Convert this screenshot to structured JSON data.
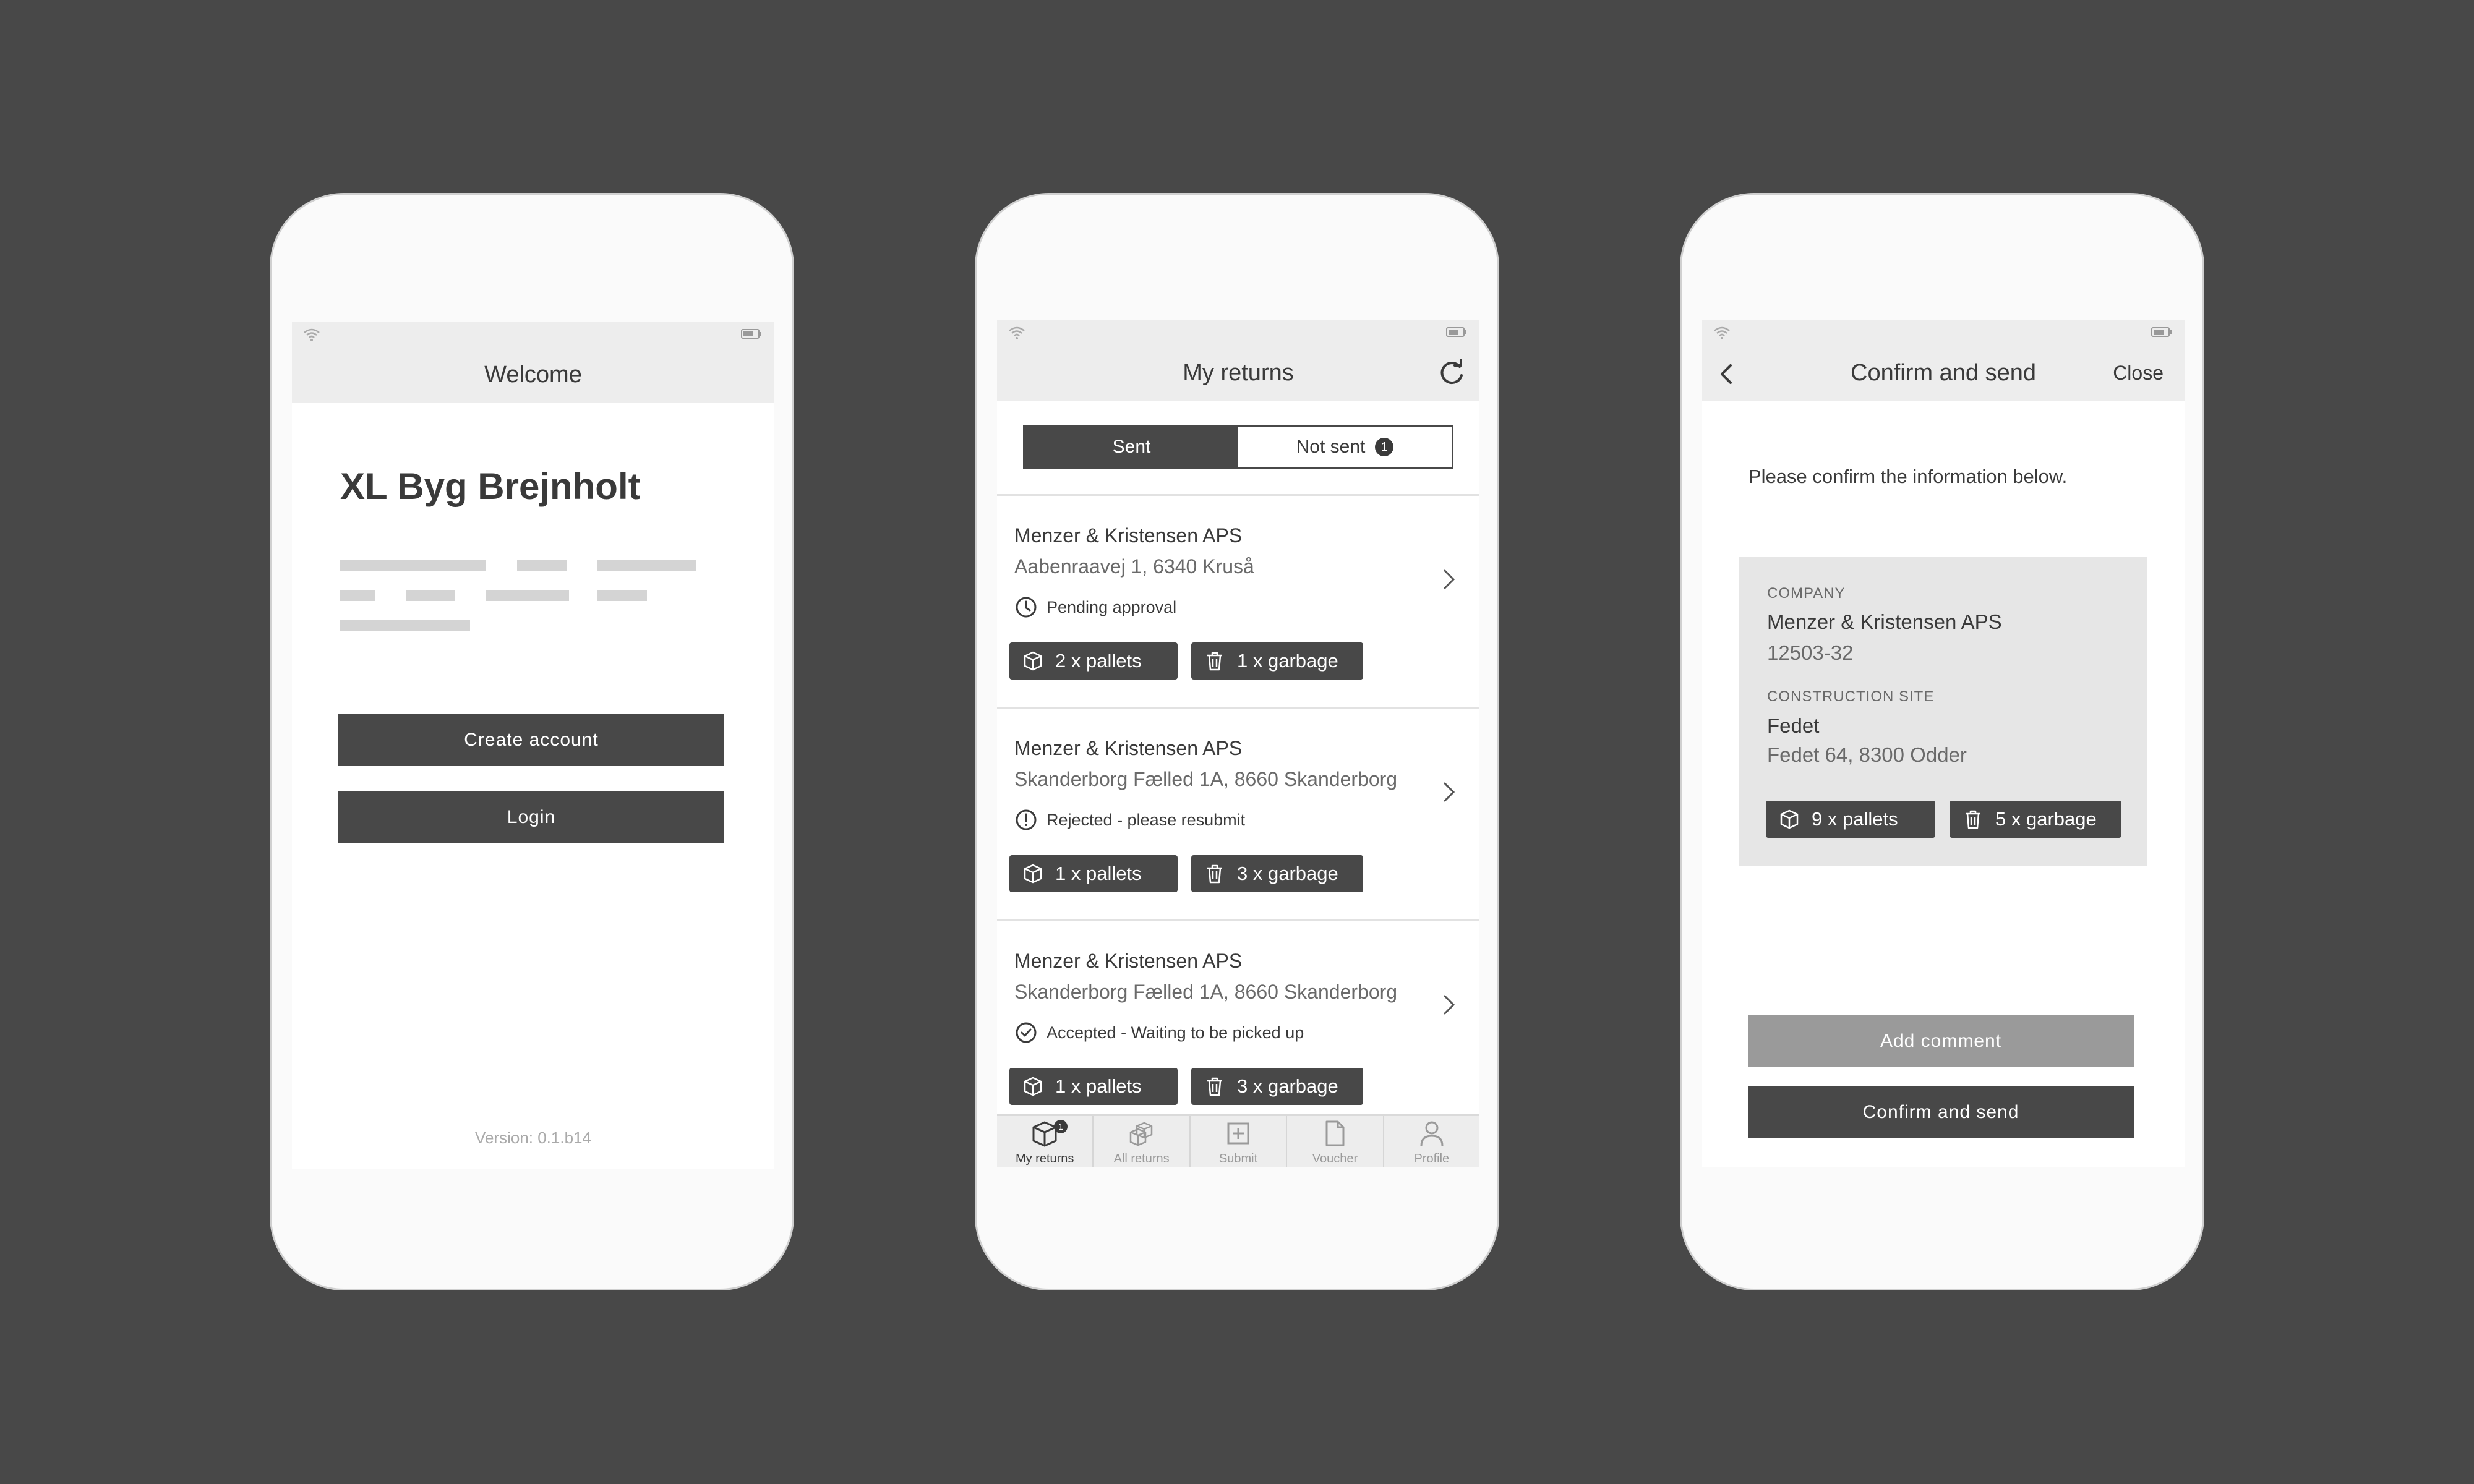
{
  "welcome_screen": {
    "title": "Welcome",
    "brand": "XL Byg Brejnholt",
    "create_account_label": "Create account",
    "login_label": "Login",
    "version": "Version: 0.1.b14"
  },
  "returns_screen": {
    "title": "My returns",
    "segments": {
      "sent": "Sent",
      "not_sent": "Not sent",
      "not_sent_count": "1"
    },
    "returns": [
      {
        "company": "Menzer & Kristensen APS",
        "address": "Aabenraavej 1, 6340 Kruså",
        "status": "Pending approval",
        "status_icon": "clock-icon",
        "pallets": "2 x pallets",
        "garbage": "1 x garbage"
      },
      {
        "company": "Menzer & Kristensen APS",
        "address": "Skanderborg Fælled 1A, 8660 Skanderborg",
        "status": "Rejected - please resubmit",
        "status_icon": "alert-icon",
        "pallets": "1 x pallets",
        "garbage": "3 x garbage"
      },
      {
        "company": "Menzer & Kristensen APS",
        "address": "Skanderborg Fælled 1A, 8660 Skanderborg",
        "status": "Accepted - Waiting to be picked up",
        "status_icon": "check-icon",
        "pallets": "1 x pallets",
        "garbage": "3 x garbage"
      }
    ],
    "tabs": [
      {
        "label": "My returns",
        "icon": "box-icon",
        "badge": "1",
        "active": true
      },
      {
        "label": "All returns",
        "icon": "boxes-icon"
      },
      {
        "label": "Submit",
        "icon": "plus-square-icon"
      },
      {
        "label": "Voucher",
        "icon": "document-icon"
      },
      {
        "label": "Profile",
        "icon": "person-icon"
      }
    ]
  },
  "confirm_screen": {
    "title": "Confirm and send",
    "close_label": "Close",
    "intro": "Please confirm the information below.",
    "company_label": "COMPANY",
    "company_name": "Menzer & Kristensen APS",
    "company_id": "12503-32",
    "site_label": "CONSTRUCTION SITE",
    "site_name": "Fedet",
    "site_address": "Fedet 64, 8300 Odder",
    "pallets": "9 x pallets",
    "garbage": "5 x garbage",
    "add_comment_label": "Add comment",
    "confirm_label": "Confirm and send"
  },
  "colors": {
    "background": "#484848",
    "dark_button": "#484848",
    "grey_button": "#9a9a9a",
    "bar": "#ededed",
    "info_box": "#e6e6e6"
  }
}
